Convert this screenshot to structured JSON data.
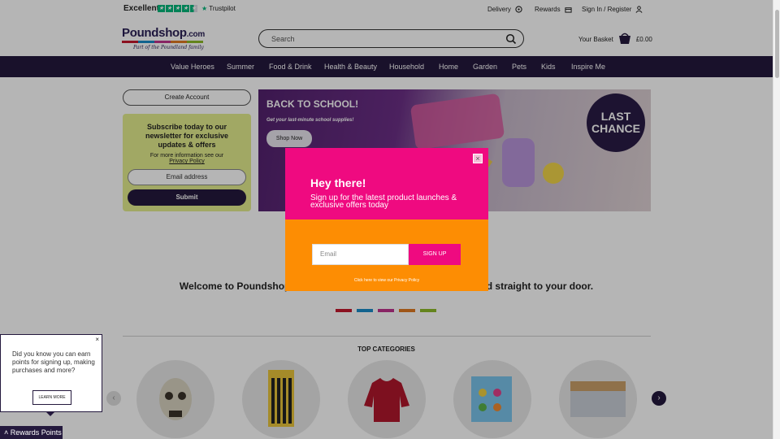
{
  "topbar": {
    "trustpilot_rating": "Excellent",
    "trustpilot_name": "Trustpilot",
    "stars": 4.5,
    "delivery": "Delivery",
    "rewards": "Rewards",
    "signin": "Sign In / Register"
  },
  "header": {
    "logo_main": "Poundshop",
    "logo_domain": ".com",
    "logo_tagline": "Part of the Poundland family",
    "search_placeholder": "Search",
    "basket_label": "Your Basket",
    "basket_total": "£0.00"
  },
  "nav": {
    "items": [
      "Value Heroes",
      "Summer",
      "Food & Drink",
      "Health & Beauty",
      "Household",
      "Home",
      "Garden",
      "Pets",
      "Kids",
      "Inspire Me"
    ]
  },
  "sidebar": {
    "create_account": "Create Account",
    "newsletter_title": "Subscribe today to our newsletter for exclusive updates & offers",
    "newsletter_info": "For more information see our",
    "privacy_link": "Privacy Policy",
    "email_placeholder": "Email address",
    "submit": "Submit"
  },
  "banner": {
    "title": "BACK TO SCHOOL!",
    "subtitle": "Get your last-minute school supplies!",
    "button": "Shop Now",
    "badge_line1": "LAST",
    "badge_line2": "CHANCE"
  },
  "main": {
    "welcome": "Welcome to Poundshop.c",
    "welcome_tail": "red straight to your door.",
    "top_categories": "TOP CATEGORIES"
  },
  "rewards_popup": {
    "close": "×",
    "text": "Did you know you can earn points for signing up, making purchases and more?",
    "learn_more": "LEARN MORE",
    "tab_label": "Rewards Points"
  },
  "modal": {
    "close": "×",
    "title": "Hey there!",
    "subtitle": "Sign up for the latest product launches & exclusive offers today",
    "email_placeholder": "Email",
    "signup": "SIGN UP",
    "privacy": "Click here to view our Privacy Policy"
  },
  "colors": {
    "brand_navy": "#24193d",
    "modal_pink": "#ef0a80",
    "modal_orange": "#fd8d03",
    "newsletter_lime": "#e3ed8d",
    "swatch_red": "#c4182e",
    "swatch_blue": "#1a8cc8",
    "swatch_pink": "#c0348e",
    "swatch_orange": "#e07a22",
    "swatch_green": "#8dbb2a"
  }
}
